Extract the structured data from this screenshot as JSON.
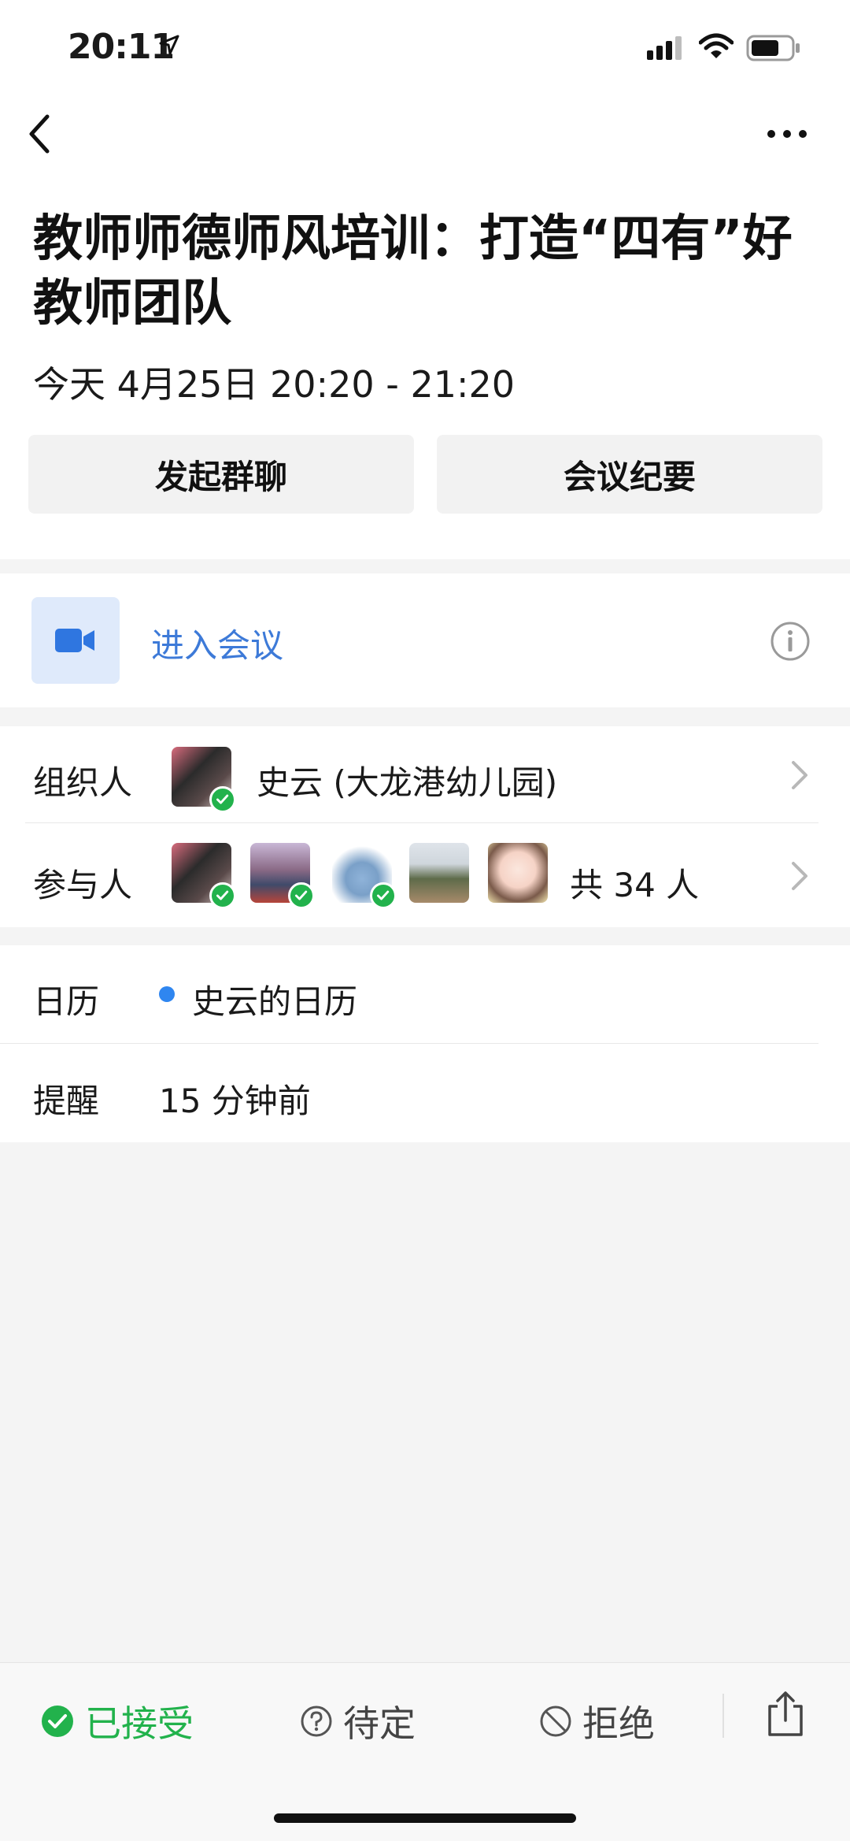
{
  "status_bar": {
    "time": "20:11"
  },
  "event": {
    "title": "教师师德师风培训：打造“四有”好教师团队",
    "time": "今天 4月25日 20:20 - 21:20"
  },
  "actions": {
    "group_chat": "发起群聊",
    "minutes": "会议纪要"
  },
  "join": {
    "label": "进入会议"
  },
  "organizer": {
    "label": "组织人",
    "name": "史云 (大龙港幼儿园)"
  },
  "participants": {
    "label": "参与人",
    "count_text": "共 34 人"
  },
  "calendar": {
    "label": "日历",
    "value": "史云的日历",
    "dot_color": "#2f86f0"
  },
  "reminder": {
    "label": "提醒",
    "value": "15 分钟前"
  },
  "responses": {
    "accepted": "已接受",
    "tentative": "待定",
    "decline": "拒绝"
  },
  "colors": {
    "accent_blue": "#3d7ad8",
    "accepted_green": "#22b24c"
  }
}
